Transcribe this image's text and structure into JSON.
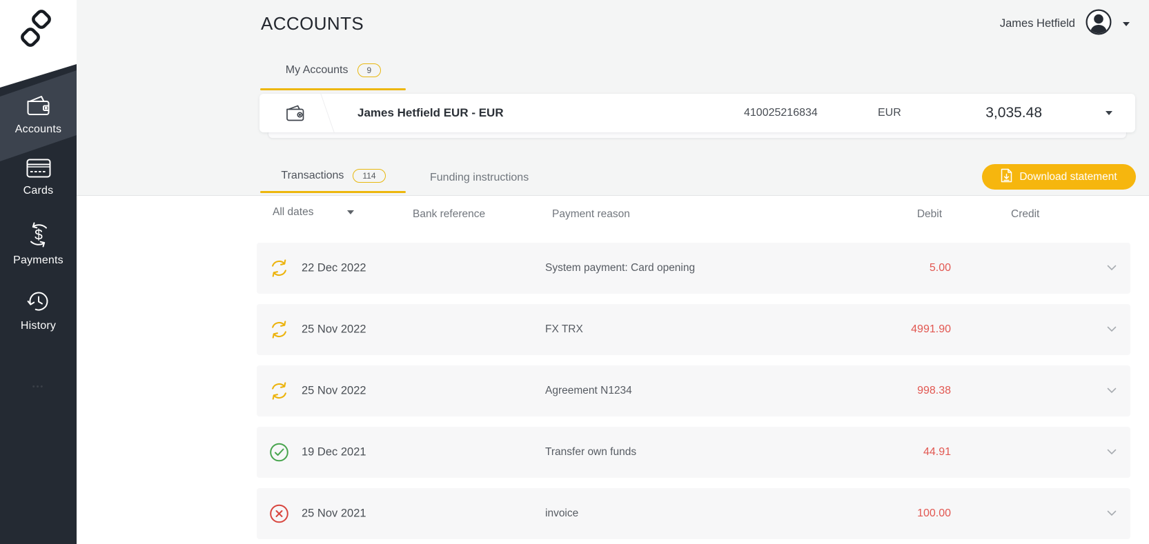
{
  "header": {
    "title": "ACCOUNTS",
    "user_name": "James Hetfield"
  },
  "sidebar": {
    "items": [
      {
        "label": "Accounts",
        "icon": "wallet-icon",
        "active": true
      },
      {
        "label": "Cards",
        "icon": "credit-card-icon",
        "active": false
      },
      {
        "label": "Payments",
        "icon": "currency-exchange-icon",
        "active": false
      },
      {
        "label": "History",
        "icon": "clock-history-icon",
        "active": false
      }
    ]
  },
  "accounts_panel": {
    "tab_label": "My Accounts",
    "tab_badge": "9",
    "account": {
      "name": "James Hetfield EUR - EUR",
      "number": "410025216834",
      "currency": "EUR",
      "balance": "3,035.48"
    }
  },
  "transactions_panel": {
    "tabs": [
      {
        "label": "Transactions",
        "badge": "114",
        "active": true
      },
      {
        "label": "Funding instructions",
        "active": false
      }
    ],
    "download_button_label": "Download statement",
    "date_filter_value": "All dates",
    "columns": {
      "bank_reference": "Bank reference",
      "payment_reason": "Payment reason",
      "debit": "Debit",
      "credit": "Credit"
    },
    "rows": [
      {
        "status": "pending",
        "date": "22 Dec 2022",
        "bank_reference": "",
        "payment_reason": "System payment: Card opening",
        "debit": "5.00",
        "credit": ""
      },
      {
        "status": "pending",
        "date": "25 Nov 2022",
        "bank_reference": "",
        "payment_reason": "FX TRX",
        "debit": "4991.90",
        "credit": ""
      },
      {
        "status": "pending",
        "date": "25 Nov 2022",
        "bank_reference": "",
        "payment_reason": "Agreement N1234",
        "debit": "998.38",
        "credit": ""
      },
      {
        "status": "completed",
        "date": "19 Dec 2021",
        "bank_reference": "",
        "payment_reason": "Transfer own funds",
        "debit": "44.91",
        "credit": ""
      },
      {
        "status": "failed",
        "date": "25 Nov 2021",
        "bank_reference": "",
        "payment_reason": "invoice",
        "debit": "100.00",
        "credit": ""
      }
    ]
  },
  "colors": {
    "accent_yellow": "#F2B60D",
    "debit_red": "#E25751",
    "success_green": "#47A44D",
    "error_red": "#D8453E",
    "pending_yellow": "#ECB30D",
    "sidebar_dark": "#242A33",
    "sidebar_active": "#3C434E",
    "top_band_gray": "#F4F5F5",
    "row_gray": "#F7F7F8"
  }
}
